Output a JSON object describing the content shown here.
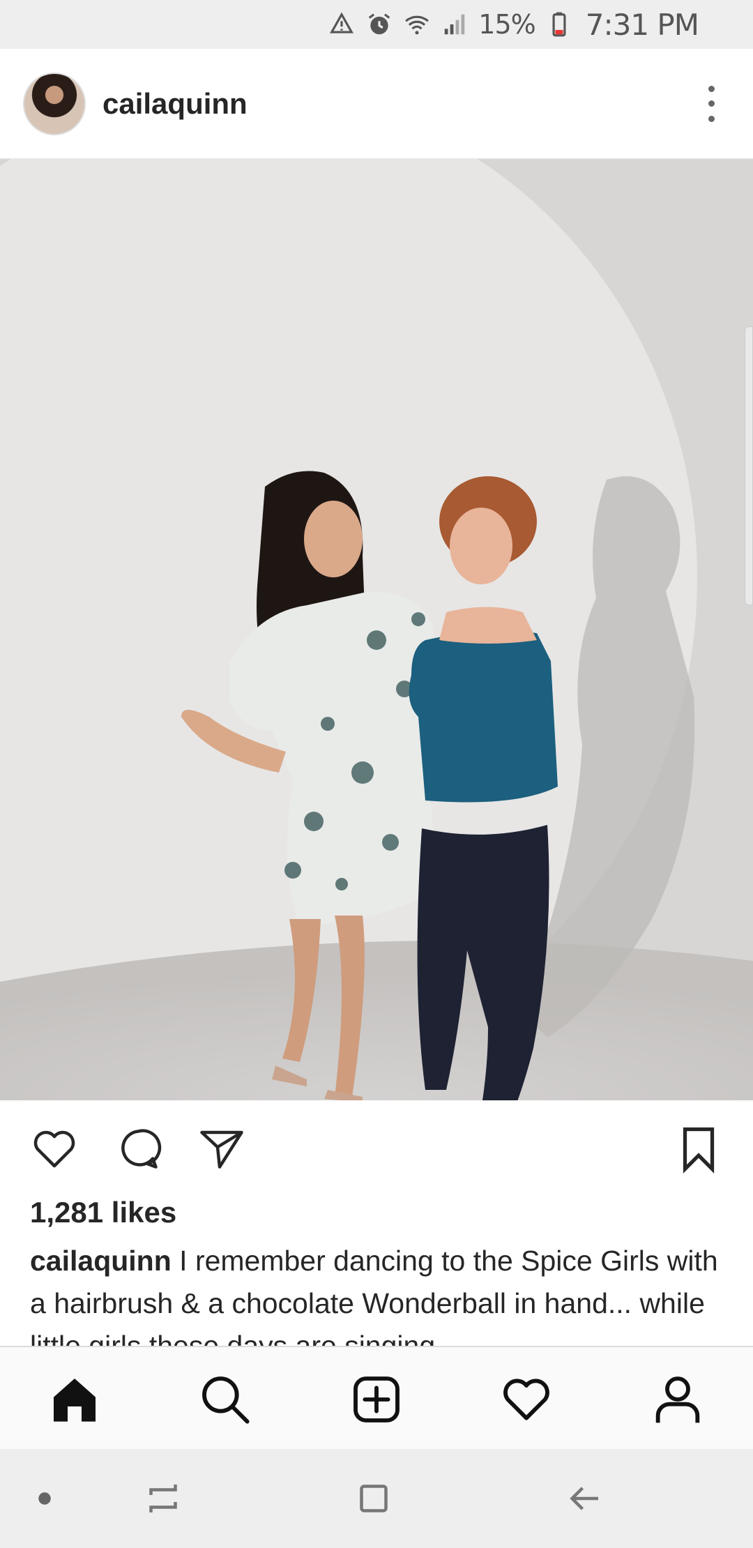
{
  "status_bar": {
    "icons": [
      "recycle-warning-icon",
      "alarm-icon",
      "wifi-icon",
      "cell-signal-icon",
      "battery-icon"
    ],
    "battery_text": "15%",
    "time": "7:31 PM",
    "battery_color": "#e53935"
  },
  "post": {
    "username": "cailaquinn",
    "likes_text": "1,281 likes",
    "caption_user": "cailaquinn",
    "caption_text": " I remember dancing to the Spice Girls with a hairbrush & a chocolate Wonderball in hand... while little girls these days are singing"
  },
  "actions": {
    "like": "heart-icon",
    "comment": "comment-icon",
    "share": "send-icon",
    "save": "bookmark-icon"
  },
  "bottom_nav": {
    "items": [
      "home-icon",
      "search-icon",
      "add-post-icon",
      "activity-heart-icon",
      "profile-icon"
    ],
    "active": "home-icon"
  },
  "system_nav": {
    "items": [
      "dot-icon",
      "recents-icon",
      "home-square-icon",
      "back-icon"
    ]
  },
  "colors": {
    "text": "#262626",
    "status_bar_bg": "#eeeeee",
    "nav_bg": "#fafafa"
  }
}
